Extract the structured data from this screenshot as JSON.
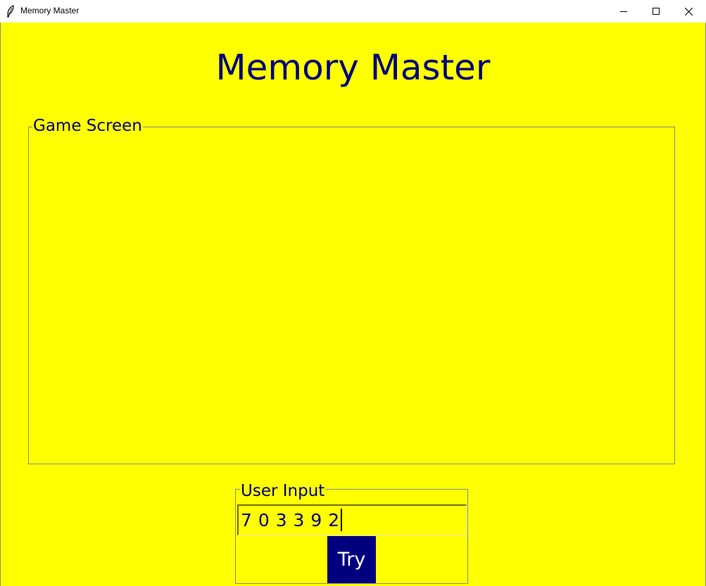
{
  "window": {
    "title": "Memory Master",
    "app_icon": "feather-icon",
    "controls": {
      "minimize_icon": "minimize-icon",
      "maximize_icon": "maximize-icon",
      "close_icon": "close-icon"
    }
  },
  "header": {
    "title": "Memory Master"
  },
  "game_screen": {
    "label": "Game Screen"
  },
  "user_input": {
    "label": "User Input",
    "value": "7 0 3 3 9 2",
    "button_label": "Try"
  },
  "colors": {
    "background": "#ffff00",
    "text": "#00007f",
    "button_bg": "#00007f",
    "button_text": "#ffffff"
  }
}
